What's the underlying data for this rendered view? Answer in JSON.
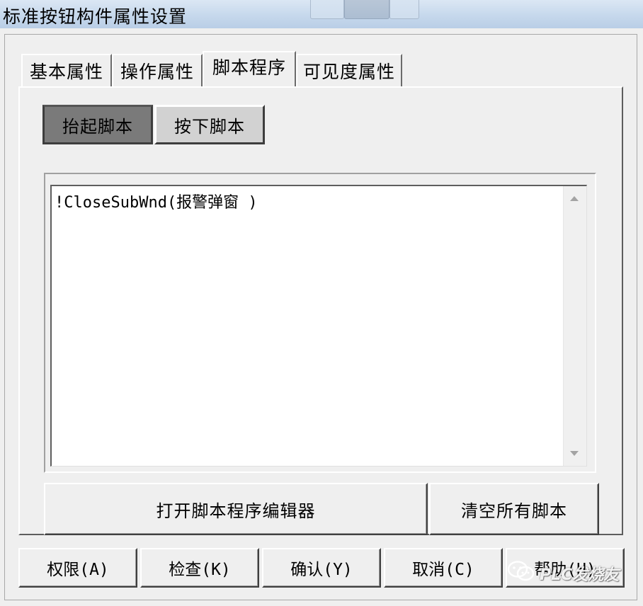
{
  "window": {
    "title": "标准按钮构件属性设置"
  },
  "tabs": [
    {
      "label": "基本属性",
      "active": false
    },
    {
      "label": "操作属性",
      "active": false
    },
    {
      "label": "脚本程序",
      "active": true
    },
    {
      "label": "可见度属性",
      "active": false
    }
  ],
  "script_tabs": [
    {
      "label": "抬起脚本",
      "selected": true
    },
    {
      "label": "按下脚本",
      "selected": false
    }
  ],
  "editor": {
    "content": "!CloseSubWnd(报警弹窗 )"
  },
  "actions": {
    "open_editor": "打开脚本程序编辑器",
    "clear_all": "清空所有脚本"
  },
  "footer_buttons": [
    {
      "label": "权限(A)"
    },
    {
      "label": "检查(K)"
    },
    {
      "label": "确认(Y)"
    },
    {
      "label": "取消(C)"
    },
    {
      "label": "帮助(H)"
    }
  ],
  "watermark": {
    "text": "PLC发烧友",
    "icon": "wechat-logo-icon"
  },
  "colors": {
    "titlebar": "#c6d8ec",
    "dialog_bg": "#efefef",
    "selected_subtab": "#7a7a7a",
    "unselected_subtab": "#d2d2d2"
  }
}
